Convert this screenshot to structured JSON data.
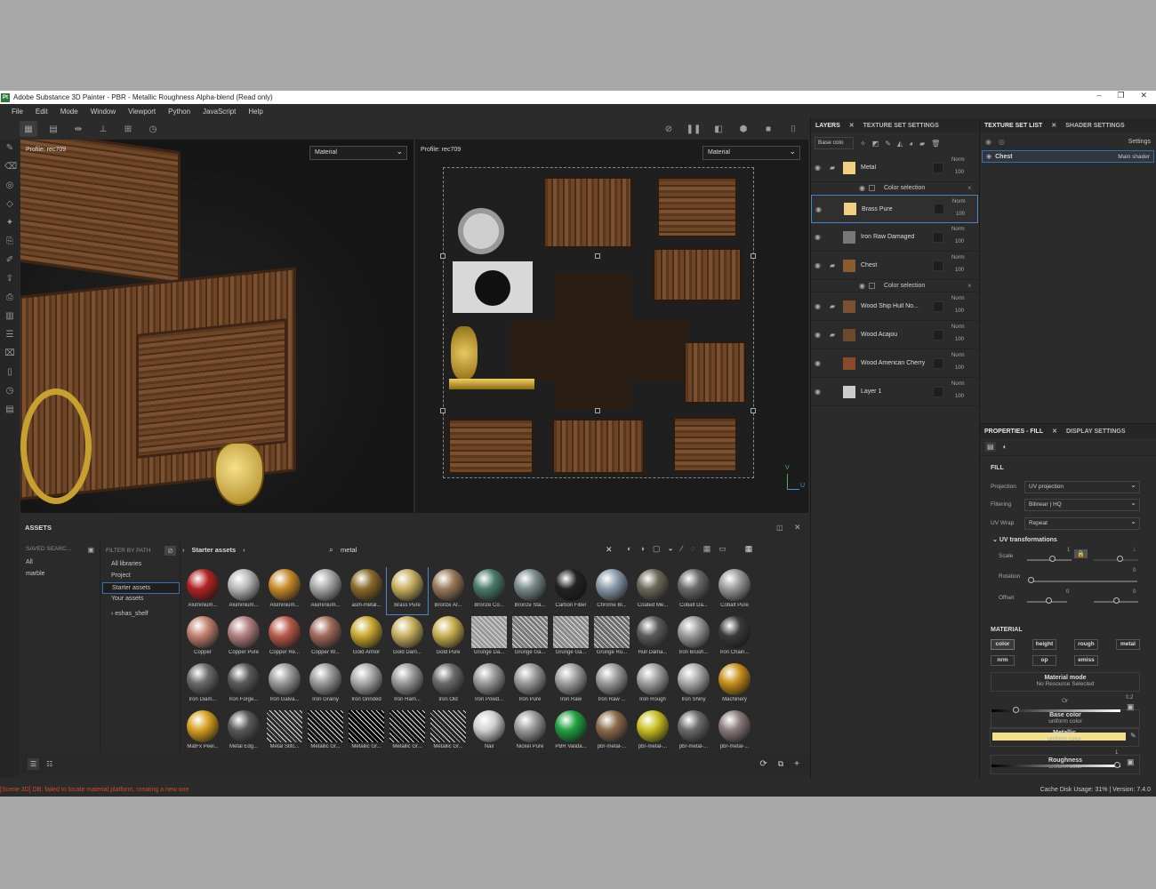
{
  "window": {
    "title": "Adobe Substance 3D Painter - PBR - Metallic Roughness Alpha-blend (Read only)",
    "icon": "Pt",
    "controls": [
      "–",
      "❐",
      "✕"
    ]
  },
  "menu": [
    "File",
    "Edit",
    "Mode",
    "Window",
    "Viewport",
    "Python",
    "JavaScript",
    "Help"
  ],
  "viewport3d": {
    "profile": "Profile: rec709",
    "mode": "Material"
  },
  "viewport2d": {
    "profile": "Profile: rec709",
    "mode": "Material",
    "axis_y": "V",
    "axis_x": "U"
  },
  "assets": {
    "title": "ASSETS",
    "saved_search_label": "SAVED SEARC...",
    "saved": [
      "All",
      "marble"
    ],
    "filter_label": "FILTER BY PATH",
    "libraries": [
      "All libraries",
      "Project",
      "Starter assets",
      "Your assets"
    ],
    "shelf": "eshas_shelf",
    "breadcrumb": "Starter assets",
    "search_value": "metal",
    "items": [
      {
        "label": "Aluminium...",
        "color": "#b22222",
        "kind": "metal"
      },
      {
        "label": "Aluminium...",
        "color": "#b8b8b8",
        "kind": "metal"
      },
      {
        "label": "Aluminium...",
        "color": "#c88a2a",
        "kind": "metal"
      },
      {
        "label": "Aluminium...",
        "color": "#a8a8a8",
        "kind": "metal"
      },
      {
        "label": "asm-metal...",
        "color": "#8a6a2a",
        "kind": "smart"
      },
      {
        "label": "Brass Pure",
        "color": "#c8b060",
        "kind": "metal"
      },
      {
        "label": "Bronze Ar...",
        "color": "#9a7a5a",
        "kind": "metal"
      },
      {
        "label": "Bronze Co...",
        "color": "#4a7a6a",
        "kind": "metal"
      },
      {
        "label": "Bronze Sta...",
        "color": "#7a8a8a",
        "kind": "metal"
      },
      {
        "label": "Carbon Fiber",
        "color": "#222222",
        "kind": "metal"
      },
      {
        "label": "Chrome Bl...",
        "color": "#8a9aaa",
        "kind": "metal"
      },
      {
        "label": "Coated Me...",
        "color": "#6a6a5a",
        "kind": "metal"
      },
      {
        "label": "Cobalt Da...",
        "color": "#6a6a6a",
        "kind": "metal"
      },
      {
        "label": "Cobalt Pure",
        "color": "#9a9a9a",
        "kind": "metal"
      },
      {
        "label": "Copper",
        "color": "#c08070",
        "kind": "metal"
      },
      {
        "label": "Copper Pure",
        "color": "#b08080",
        "kind": "metal"
      },
      {
        "label": "Copper Re...",
        "color": "#b85a4a",
        "kind": "metal"
      },
      {
        "label": "Copper W...",
        "color": "#a06a5a",
        "kind": "metal"
      },
      {
        "label": "Gold Armor",
        "color": "#c8a830",
        "kind": "metal"
      },
      {
        "label": "Gold Dam...",
        "color": "#c8b060",
        "kind": "metal"
      },
      {
        "label": "Gold Pure",
        "color": "#c8b050",
        "kind": "metal"
      },
      {
        "label": "Grunge Da...",
        "color": "#9a9a9a",
        "kind": "tex"
      },
      {
        "label": "Grunge Ga...",
        "color": "#7a7a7a",
        "kind": "tex"
      },
      {
        "label": "Grunge Ga...",
        "color": "#8a8a8a",
        "kind": "tex"
      },
      {
        "label": "Grunge Ru...",
        "color": "#6a6a6a",
        "kind": "tex"
      },
      {
        "label": "Hull Dama...",
        "color": "#5a5a5a",
        "kind": "metal"
      },
      {
        "label": "Iron Brush...",
        "color": "#9a9a9a",
        "kind": "metal"
      },
      {
        "label": "Iron Chain...",
        "color": "#3a3a3a",
        "kind": "metal"
      },
      {
        "label": "Iron Diam...",
        "color": "#6a6a6a",
        "kind": "metal"
      },
      {
        "label": "Iron Forge...",
        "color": "#5a5a5a",
        "kind": "metal"
      },
      {
        "label": "Iron Galva...",
        "color": "#9a9a9a",
        "kind": "metal"
      },
      {
        "label": "Iron Grainy",
        "color": "#9a9a9a",
        "kind": "metal"
      },
      {
        "label": "Iron Grinded",
        "color": "#aaaaaa",
        "kind": "metal"
      },
      {
        "label": "Iron Ham...",
        "color": "#9a9a9a",
        "kind": "metal"
      },
      {
        "label": "Iron Old",
        "color": "#6a6a6a",
        "kind": "metal"
      },
      {
        "label": "Iron Powd...",
        "color": "#9a9a9a",
        "kind": "metal"
      },
      {
        "label": "Iron Pure",
        "color": "#9a9a9a",
        "kind": "metal"
      },
      {
        "label": "Iron Raw",
        "color": "#a0a0a0",
        "kind": "metal"
      },
      {
        "label": "Iron Raw ...",
        "color": "#9a9a9a",
        "kind": "metal"
      },
      {
        "label": "Iron Rough",
        "color": "#a0a0a0",
        "kind": "metal"
      },
      {
        "label": "Iron Shiny",
        "color": "#aaaaaa",
        "kind": "metal"
      },
      {
        "label": "Machinery",
        "color": "#c8901a",
        "kind": "metal"
      },
      {
        "label": "MatFx Peel...",
        "color": "#d8a020",
        "kind": "metal"
      },
      {
        "label": "Metal Edg...",
        "color": "#5a5a5a",
        "kind": "metal"
      },
      {
        "label": "Metal Stitc...",
        "color": "#2a2a2a",
        "kind": "tex"
      },
      {
        "label": "Metallic Gr...",
        "color": "#111111",
        "kind": "tex"
      },
      {
        "label": "Metallic Gr...",
        "color": "#000000",
        "kind": "tex"
      },
      {
        "label": "Metallic Gr...",
        "color": "#111111",
        "kind": "tex"
      },
      {
        "label": "Metallic Gr...",
        "color": "#222222",
        "kind": "tex"
      },
      {
        "label": "Nail",
        "color": "#d0d0d0",
        "kind": "metal"
      },
      {
        "label": "Nickel Pure",
        "color": "#9a9a9a",
        "kind": "metal"
      },
      {
        "label": "PBR Valida...",
        "color": "#20a040",
        "kind": "metal"
      },
      {
        "label": "pbr-metal-...",
        "color": "#8a6a4a",
        "kind": "smart"
      },
      {
        "label": "pbr-metal-...",
        "color": "#c8c020",
        "kind": "smart"
      },
      {
        "label": "pbr-metal-...",
        "color": "#6a6a6a",
        "kind": "smart"
      },
      {
        "label": "pbr-metal-...",
        "color": "#8a7a7a",
        "kind": "smart"
      }
    ]
  },
  "layers": {
    "tabs": [
      "LAYERS",
      "TEXTURE SET SETTINGS"
    ],
    "blend_mode": "Base colo",
    "rows": [
      {
        "name": "Metal",
        "blend": "Norm",
        "opacity": "100",
        "thumb": "#f0d080",
        "folder": true,
        "sub": "Color selection"
      },
      {
        "name": "Brass Pure",
        "blend": "Norm",
        "opacity": "100",
        "thumb": "#f0d080",
        "folder": false,
        "selected": true
      },
      {
        "name": "Iron Raw Damaged",
        "blend": "Norm",
        "opacity": "100",
        "thumb": "#777777",
        "folder": false
      },
      {
        "name": "Chest",
        "blend": "Norm",
        "opacity": "100",
        "thumb": "#8a5a30",
        "folder": true,
        "sub": "Color selection"
      },
      {
        "name": "Wood Ship Hull No...",
        "blend": "Norm",
        "opacity": "100",
        "thumb": "#7a5030",
        "folder": true
      },
      {
        "name": "Wood Acajou",
        "blend": "Norm",
        "opacity": "100",
        "thumb": "#6a4a2a",
        "folder": true
      },
      {
        "name": "Wood American Cherry",
        "blend": "Norm",
        "opacity": "100",
        "thumb": "#8a4a2a",
        "folder": false
      },
      {
        "name": "Layer 1",
        "blend": "Norm",
        "opacity": "100",
        "thumb": "#cccccc",
        "folder": false
      }
    ]
  },
  "texture_sets": {
    "tabs": [
      "TEXTURE SET LIST",
      "SHADER SETTINGS"
    ],
    "settings_label": "Settings",
    "item": "Chest",
    "shader": "Main shader"
  },
  "properties": {
    "tabs": [
      "PROPERTIES - FILL",
      "DISPLAY SETTINGS"
    ],
    "section": "FILL",
    "projection_label": "Projection",
    "projection": "UV projection",
    "filtering_label": "Filtering",
    "filtering": "Bilinear | HQ",
    "uvwrap_label": "UV Wrap",
    "uvwrap": "Repeat",
    "uv_header": "UV transformations",
    "scale_label": "Scale",
    "scale": "1",
    "scale_extra": "1",
    "rotation_label": "Rotation",
    "rotation": "0",
    "offset_label": "Offset",
    "offset_u": "0",
    "offset_v": "0",
    "material_label": "MATERIAL",
    "channels": [
      "color",
      "height",
      "rough",
      "metal",
      "nrm",
      "op",
      "emiss"
    ],
    "material_mode": "Material mode",
    "no_resource": "No Resource Selected",
    "or_label": "Or",
    "base_color": "Base color",
    "uniform": "uniform color",
    "base_color_value": "#f2df8c",
    "roughness": "Roughness",
    "roughness_value": "0.2",
    "metallic": "Metallic",
    "metallic_value": "1"
  },
  "status": {
    "error": "[Scene 3D] DB: failed to locate material platform, creating a new one",
    "cache": "Cache Disk Usage: 31% | Version: 7.4.0",
    "error_color": "#d04a2a"
  }
}
